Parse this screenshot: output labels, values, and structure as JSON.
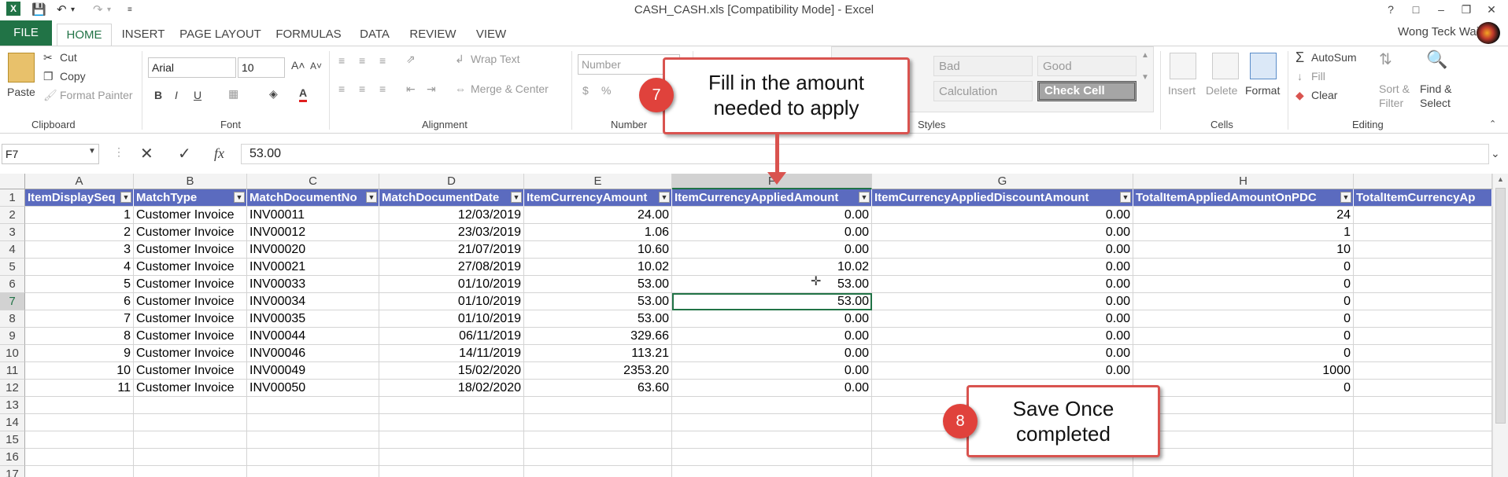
{
  "window": {
    "title": "CASH_CASH.xls  [Compatibility Mode] - Excel",
    "help": "?",
    "user": "Wong Teck Wai"
  },
  "tabs": [
    "FILE",
    "HOME",
    "INSERT",
    "PAGE LAYOUT",
    "FORMULAS",
    "DATA",
    "REVIEW",
    "VIEW"
  ],
  "ribbon": {
    "clipboard": {
      "paste": "Paste",
      "cut": "Cut",
      "copy": "Copy",
      "format_painter": "Format Painter",
      "label": "Clipboard"
    },
    "font": {
      "name": "Arial",
      "size": "10",
      "label": "Font",
      "bold": "B",
      "italic": "I",
      "underline": "U"
    },
    "alignment": {
      "wrap": "Wrap Text",
      "merge": "Merge & Center",
      "label": "Alignment"
    },
    "number": {
      "format": "Number",
      "label": "Number"
    },
    "styles": {
      "bad": "Bad",
      "good": "Good",
      "calculation": "Calculation",
      "check_cell": "Check Cell",
      "label": "Styles"
    },
    "cells": {
      "insert": "Insert",
      "delete": "Delete",
      "format": "Format",
      "label": "Cells"
    },
    "editing": {
      "autosum": "AutoSum",
      "fill": "Fill",
      "clear": "Clear",
      "sort": "Sort &",
      "filter": "Filter",
      "find": "Find &",
      "select": "Select",
      "label": "Editing"
    }
  },
  "formula_bar": {
    "name_box": "F7",
    "fx": "fx",
    "value": "53.00"
  },
  "columns": [
    "A",
    "B",
    "C",
    "D",
    "E",
    "F",
    "G",
    "H"
  ],
  "headers": [
    "ItemDisplaySeq",
    "MatchType",
    "MatchDocumentNo",
    "MatchDocumentDate",
    "ItemCurrencyAmount",
    "ItemCurrencyAppliedAmount",
    "ItemCurrencyAppliedDiscountAmount",
    "TotalItemAppliedAmountOnPDC",
    "TotalItemCurrencyAp"
  ],
  "rows": [
    [
      "1",
      "Customer Invoice",
      "INV00011",
      "12/03/2019",
      "24.00",
      "0.00",
      "0.00",
      "24"
    ],
    [
      "2",
      "Customer Invoice",
      "INV00012",
      "23/03/2019",
      "1.06",
      "0.00",
      "0.00",
      "1"
    ],
    [
      "3",
      "Customer Invoice",
      "INV00020",
      "21/07/2019",
      "10.60",
      "0.00",
      "0.00",
      "10"
    ],
    [
      "4",
      "Customer Invoice",
      "INV00021",
      "27/08/2019",
      "10.02",
      "10.02",
      "0.00",
      "0"
    ],
    [
      "5",
      "Customer Invoice",
      "INV00033",
      "01/10/2019",
      "53.00",
      "53.00",
      "0.00",
      "0"
    ],
    [
      "6",
      "Customer Invoice",
      "INV00034",
      "01/10/2019",
      "53.00",
      "53.00",
      "0.00",
      "0"
    ],
    [
      "7",
      "Customer Invoice",
      "INV00035",
      "01/10/2019",
      "53.00",
      "0.00",
      "0.00",
      "0"
    ],
    [
      "8",
      "Customer Invoice",
      "INV00044",
      "06/11/2019",
      "329.66",
      "0.00",
      "0.00",
      "0"
    ],
    [
      "9",
      "Customer Invoice",
      "INV00046",
      "14/11/2019",
      "113.21",
      "0.00",
      "0.00",
      "0"
    ],
    [
      "10",
      "Customer Invoice",
      "INV00049",
      "15/02/2020",
      "2353.20",
      "0.00",
      "0.00",
      "1000"
    ],
    [
      "11",
      "Customer Invoice",
      "INV00050",
      "18/02/2020",
      "63.60",
      "0.00",
      "",
      "0"
    ]
  ],
  "row_numbers": [
    "1",
    "2",
    "3",
    "4",
    "5",
    "6",
    "7",
    "8",
    "9",
    "10",
    "11",
    "12",
    "13",
    "14",
    "15",
    "16",
    "17"
  ],
  "callouts": {
    "step7": {
      "num": "7",
      "line1": "Fill in the amount",
      "line2": "needed to apply"
    },
    "step8": {
      "num": "8",
      "line1": "Save Once",
      "line2": "completed"
    }
  },
  "colors": {
    "accent": "#217346",
    "header_fill": "#5b6bbf",
    "callout_border": "#d9534f",
    "badge": "#e0423c"
  }
}
